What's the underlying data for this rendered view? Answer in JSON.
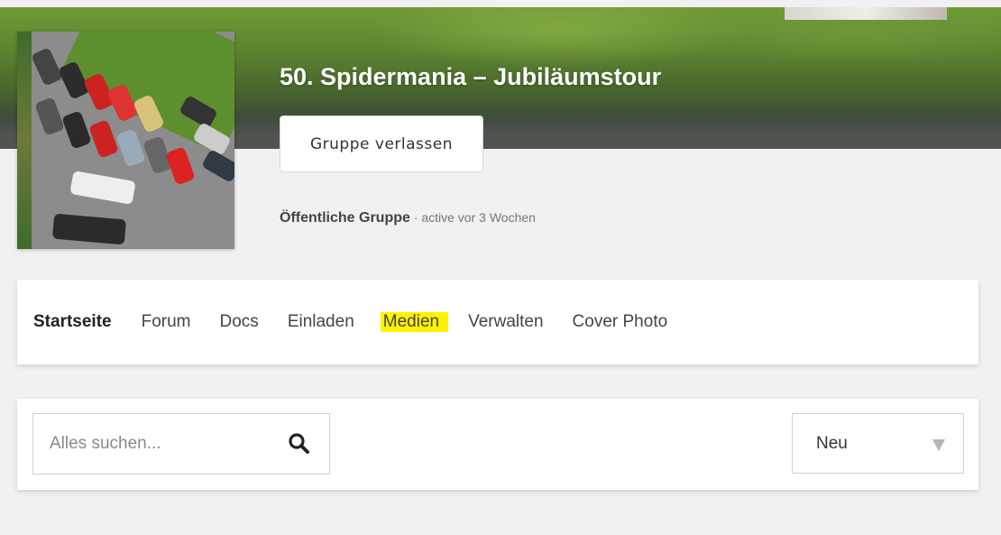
{
  "group": {
    "title": "50. Spidermania – Jubiläumstour",
    "leave_label": "Gruppe verlassen",
    "visibility": "Öffentliche Gruppe",
    "activity": "· active vor 3 Wochen"
  },
  "nav": {
    "tabs": [
      {
        "label": "Startseite",
        "active": true
      },
      {
        "label": "Forum"
      },
      {
        "label": "Docs"
      },
      {
        "label": "Einladen"
      },
      {
        "label": "Medien",
        "highlighted": true
      },
      {
        "label": "Verwalten"
      },
      {
        "label": "Cover Photo"
      }
    ]
  },
  "filters": {
    "search_placeholder": "Alles suchen...",
    "search_icon": "search-icon",
    "sort_value": "Neu",
    "sort_icon": "chevron-down-icon"
  },
  "colors": {
    "highlight": "#fff200",
    "title": "#ffffff"
  }
}
